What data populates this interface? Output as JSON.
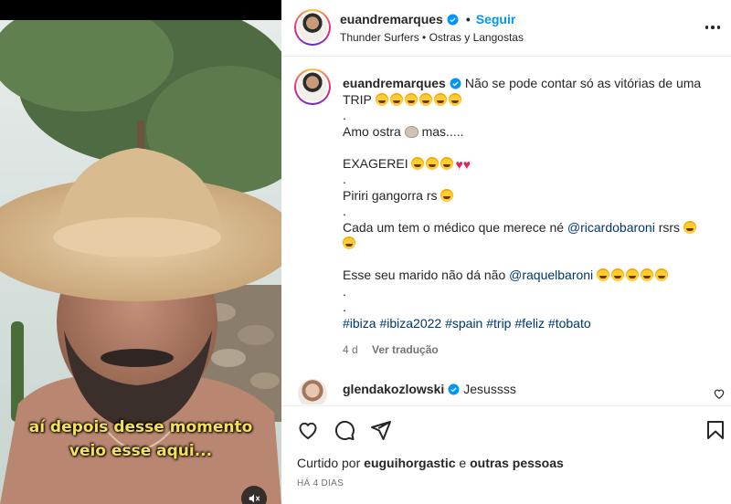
{
  "post": {
    "username": "euandremarques",
    "follow_label": "Seguir",
    "location": "Thunder Surfers • Ostras y Langostas",
    "video_caption": [
      "aí depois desse momento",
      "veio esse aqui..."
    ]
  },
  "caption": {
    "line1_text": "Não se pode contar só as vitórias de uma",
    "line2_text": "TRIP",
    "dot": ".",
    "line4_text": "Amo ostra",
    "line4_tail": "mas.....",
    "line6_text": "EXAGEREI",
    "line8_text": "Piriri gangorra rs",
    "line10_text": "Cada um tem o médico que merece né",
    "line10_mention": "@ricardobaroni",
    "line10_tail": "rsrs",
    "line13_text": "Esse seu marido não dá não",
    "line13_mention": "@raquelbaroni",
    "hashtags": "#ibiza #ibiza2022 #spain #trip #feliz #tobato",
    "age": "4 d",
    "translate_label": "Ver tradução"
  },
  "comment2": {
    "username": "glendakozlowski",
    "text": "Jesussss"
  },
  "footer": {
    "liked_by_prefix": "Curtido por",
    "liked_by_user": "euguihorgastic",
    "liked_by_and": "e",
    "liked_by_others": "outras pessoas",
    "timestamp": "HÁ 4 DIAS"
  },
  "colors": {
    "accent": "#0095f6",
    "link": "#00376b",
    "caption_text": "#f5e05a"
  }
}
